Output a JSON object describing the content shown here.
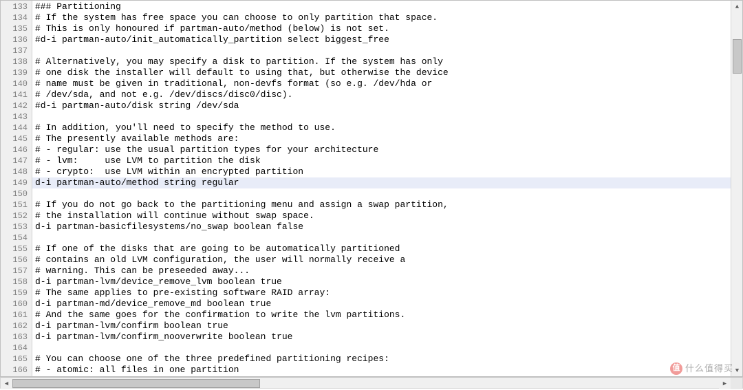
{
  "editor": {
    "startLine": 133,
    "highlightedLine": 149,
    "lines": [
      "### Partitioning",
      "# If the system has free space you can choose to only partition that space.",
      "# This is only honoured if partman-auto/method (below) is not set.",
      "#d-i partman-auto/init_automatically_partition select biggest_free",
      "",
      "# Alternatively, you may specify a disk to partition. If the system has only",
      "# one disk the installer will default to using that, but otherwise the device",
      "# name must be given in traditional, non-devfs format (so e.g. /dev/hda or",
      "# /dev/sda, and not e.g. /dev/discs/disc0/disc).",
      "#d-i partman-auto/disk string /dev/sda",
      "",
      "# In addition, you'll need to specify the method to use.",
      "# The presently available methods are:",
      "# - regular: use the usual partition types for your architecture",
      "# - lvm:     use LVM to partition the disk",
      "# - crypto:  use LVM within an encrypted partition",
      "d-i partman-auto/method string regular",
      "",
      "# If you do not go back to the partitioning menu and assign a swap partition,",
      "# the installation will continue without swap space.",
      "d-i partman-basicfilesystems/no_swap boolean false",
      "",
      "# If one of the disks that are going to be automatically partitioned",
      "# contains an old LVM configuration, the user will normally receive a",
      "# warning. This can be preseeded away...",
      "d-i partman-lvm/device_remove_lvm boolean true",
      "# The same applies to pre-existing software RAID array:",
      "d-i partman-md/device_remove_md boolean true",
      "# And the same goes for the confirmation to write the lvm partitions.",
      "d-i partman-lvm/confirm boolean true",
      "d-i partman-lvm/confirm_nooverwrite boolean true",
      "",
      "# You can choose one of the three predefined partitioning recipes:",
      "# - atomic: all files in one partition"
    ]
  },
  "watermark": {
    "icon": "值",
    "text": "什么值得买"
  }
}
